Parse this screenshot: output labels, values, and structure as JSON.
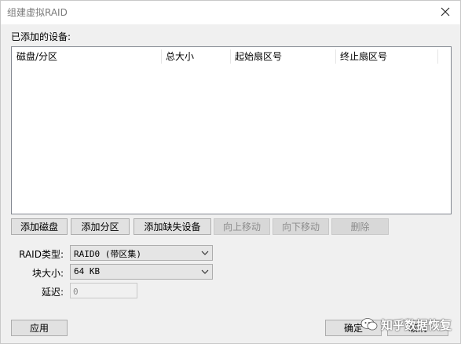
{
  "window": {
    "title": "组建虚拟RAID"
  },
  "devices": {
    "section_label": "已添加的设备:",
    "columns": [
      "磁盘/分区",
      "总大小",
      "起始扇区号",
      "终止扇区号"
    ],
    "rows": []
  },
  "toolbar": {
    "add_disk": "添加磁盘",
    "add_partition": "添加分区",
    "add_missing": "添加缺失设备",
    "move_up": "向上移动",
    "move_down": "向下移动",
    "delete": "删除"
  },
  "form": {
    "raid_type_label": "RAID类型:",
    "raid_type_value": "RAID0 (带区集)",
    "block_size_label": "块大小:",
    "block_size_value": "64 KB",
    "delay_label": "延迟:",
    "delay_value": "0"
  },
  "footer": {
    "apply": "应用",
    "ok": "确定",
    "cancel": "取消"
  },
  "watermark": {
    "text": "知乎数据恢复"
  }
}
